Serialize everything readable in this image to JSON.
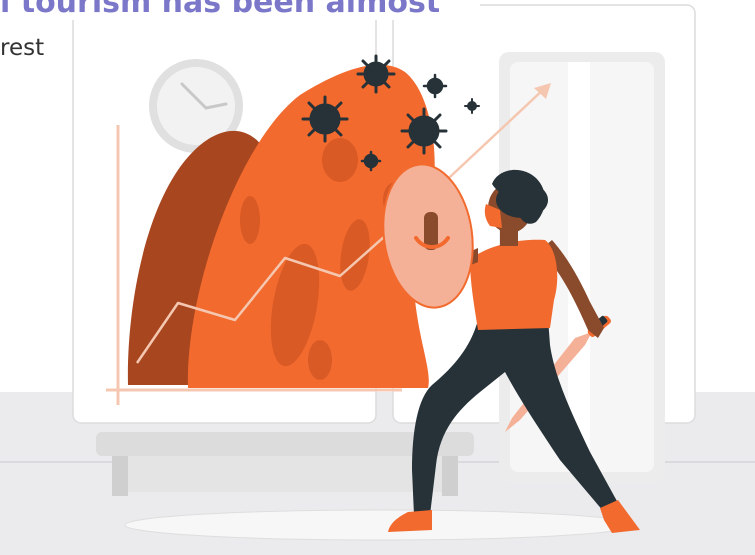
{
  "article": {
    "headline_fragment": "l tourism has been almost",
    "body_fragment": "rest"
  },
  "illustration": {
    "subject": "person-with-shield-and-sword-facing-virus-monster",
    "colors": {
      "orange": "#f26a2e",
      "dark_orange": "#a8461f",
      "skin": "#8a4a2c",
      "dark": "#263238",
      "peach": "#f5b197",
      "floor": "#ebebee",
      "headline": "#7b78c9"
    }
  }
}
